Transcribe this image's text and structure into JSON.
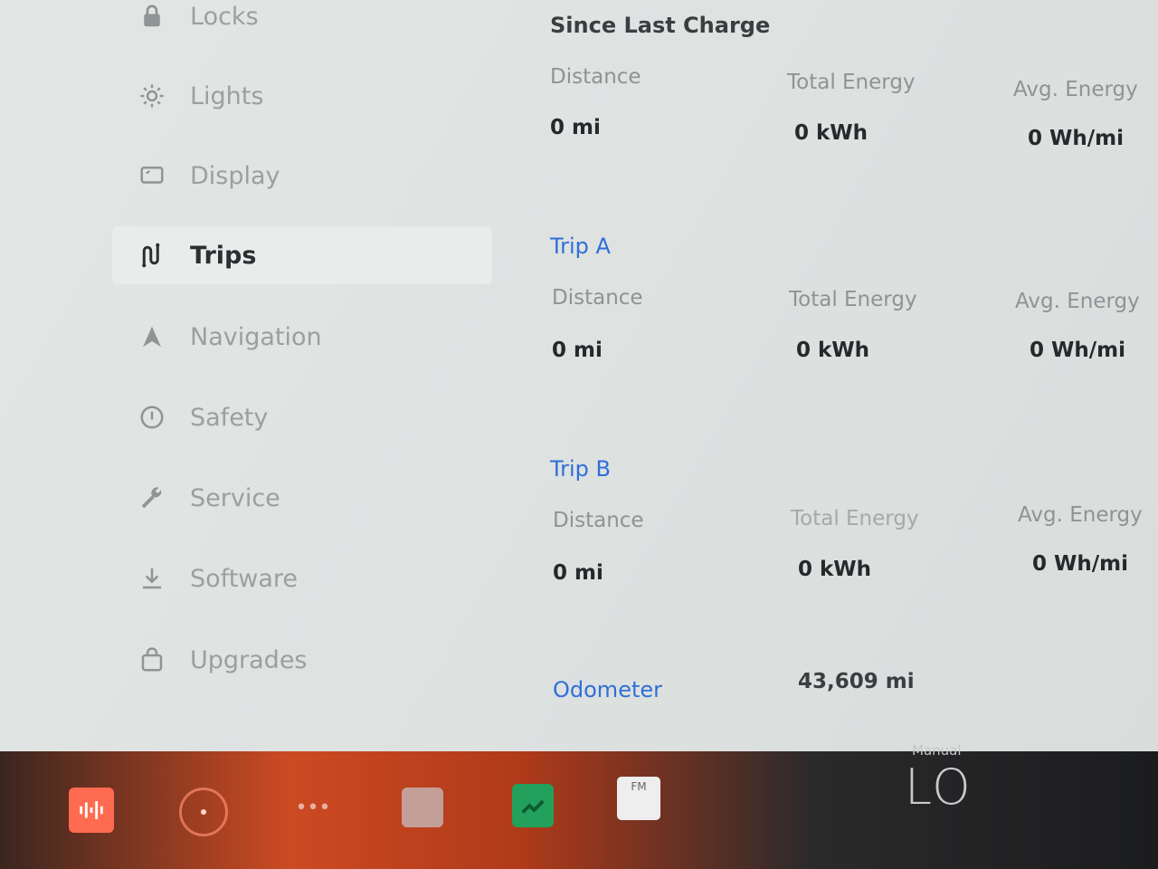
{
  "sidebar": {
    "items": [
      {
        "label": "Locks",
        "icon": "lock-icon",
        "active": false
      },
      {
        "label": "Lights",
        "icon": "sun-icon",
        "active": false
      },
      {
        "label": "Display",
        "icon": "display-icon",
        "active": false
      },
      {
        "label": "Trips",
        "icon": "trips-icon",
        "active": true
      },
      {
        "label": "Navigation",
        "icon": "navigation-icon",
        "active": false
      },
      {
        "label": "Safety",
        "icon": "safety-icon",
        "active": false
      },
      {
        "label": "Service",
        "icon": "wrench-icon",
        "active": false
      },
      {
        "label": "Software",
        "icon": "download-icon",
        "active": false
      },
      {
        "label": "Upgrades",
        "icon": "bag-icon",
        "active": false
      }
    ]
  },
  "sections": [
    {
      "title": "Since Last Charge",
      "columns": [
        {
          "label": "Distance",
          "value": "0 mi"
        },
        {
          "label": "Total Energy",
          "value": "0 kWh"
        },
        {
          "label": "Avg. Energy",
          "value": "0 Wh/mi"
        }
      ]
    },
    {
      "title": "Trip A",
      "columns": [
        {
          "label": "Distance",
          "value": "0 mi"
        },
        {
          "label": "Total Energy",
          "value": "0 kWh"
        },
        {
          "label": "Avg. Energy",
          "value": "0 Wh/mi"
        }
      ]
    },
    {
      "title": "Trip B",
      "columns": [
        {
          "label": "Distance",
          "value": "0 mi"
        },
        {
          "label": "Total Energy",
          "value": "0 kWh"
        },
        {
          "label": "Avg. Energy",
          "value": "0 Wh/mi"
        }
      ]
    }
  ],
  "odometer": {
    "label": "Odometer",
    "value": "43,609 mi"
  },
  "taskbar": {
    "more_label": "•••",
    "fm_label": "FM",
    "climate_mode": "Manual",
    "climate_temp": "LO"
  },
  "colors": {
    "accent": "#2f6fd8",
    "active_item_bg": "#eaecec"
  }
}
